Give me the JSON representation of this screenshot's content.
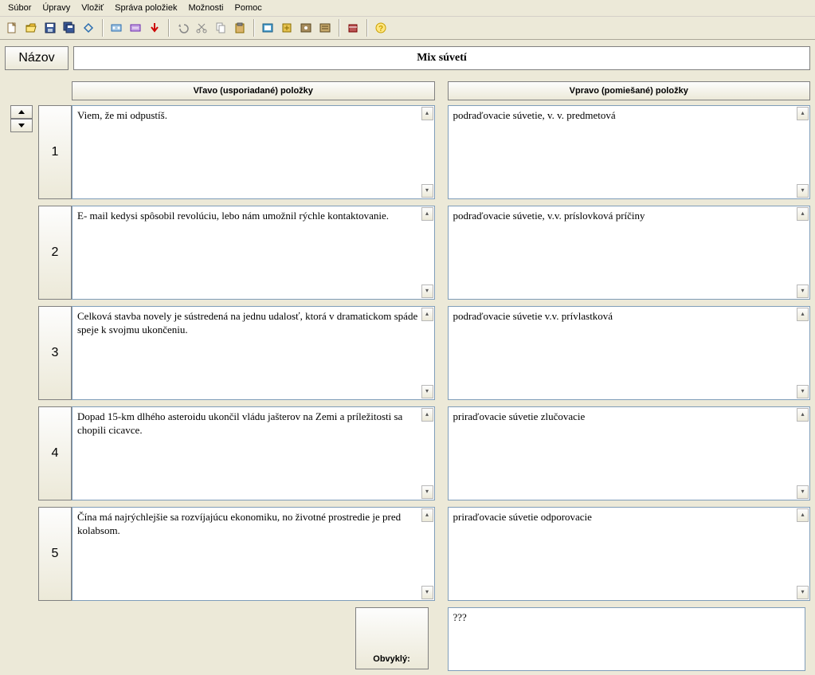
{
  "menu": {
    "items": [
      "Súbor",
      "Úpravy",
      "Vložiť",
      "Správa položiek",
      "Možnosti",
      "Pomoc"
    ]
  },
  "toolbar_icons": [
    "new-file",
    "open-folder",
    "save",
    "save-all",
    "preview",
    "sep",
    "wizard1",
    "wizard2",
    "arrow-down-red",
    "sep",
    "undo",
    "cut",
    "copy",
    "paste",
    "sep",
    "export1",
    "export2",
    "export3",
    "export4",
    "sep",
    "package",
    "sep",
    "help"
  ],
  "title": {
    "button": "Názov",
    "value": "Mix súvetí"
  },
  "headers": {
    "left": "Vľavo (usporiadané) položky",
    "right": "Vpravo (pomiešané) položky"
  },
  "rows": [
    {
      "num": "1",
      "left": "Viem, že mi odpustíš.",
      "right": "podraďovacie súvetie, v. v. predmetová"
    },
    {
      "num": "2",
      "left": "E- mail kedysi spôsobil revolúciu, lebo nám  umožnil rýchle kontaktovanie.",
      "right": "podraďovacie súvetie, v.v. príslovková príčiny"
    },
    {
      "num": "3",
      "left": "Celková stavba novely je sústredená na jednu udalosť, ktorá v dramatickom spáde speje k svojmu ukončeniu.",
      "right": "podraďovacie súvetie v.v. prívlastková"
    },
    {
      "num": "4",
      "left": "Dopad 15-km dlhého asteroidu ukončil vládu jašterov na Zemi a príležitosti sa chopili cicavce.",
      "right": "priraďovacie súvetie zlučovacie"
    },
    {
      "num": "5",
      "left": "Čína má najrýchlejšie sa rozvíjajúcu ekonomiku, no  životné prostredie je pred kolabsom.",
      "right": "priraďovacie súvetie odporovacie"
    }
  ],
  "bottom": {
    "label": "Obvyklý:",
    "value": "???"
  }
}
